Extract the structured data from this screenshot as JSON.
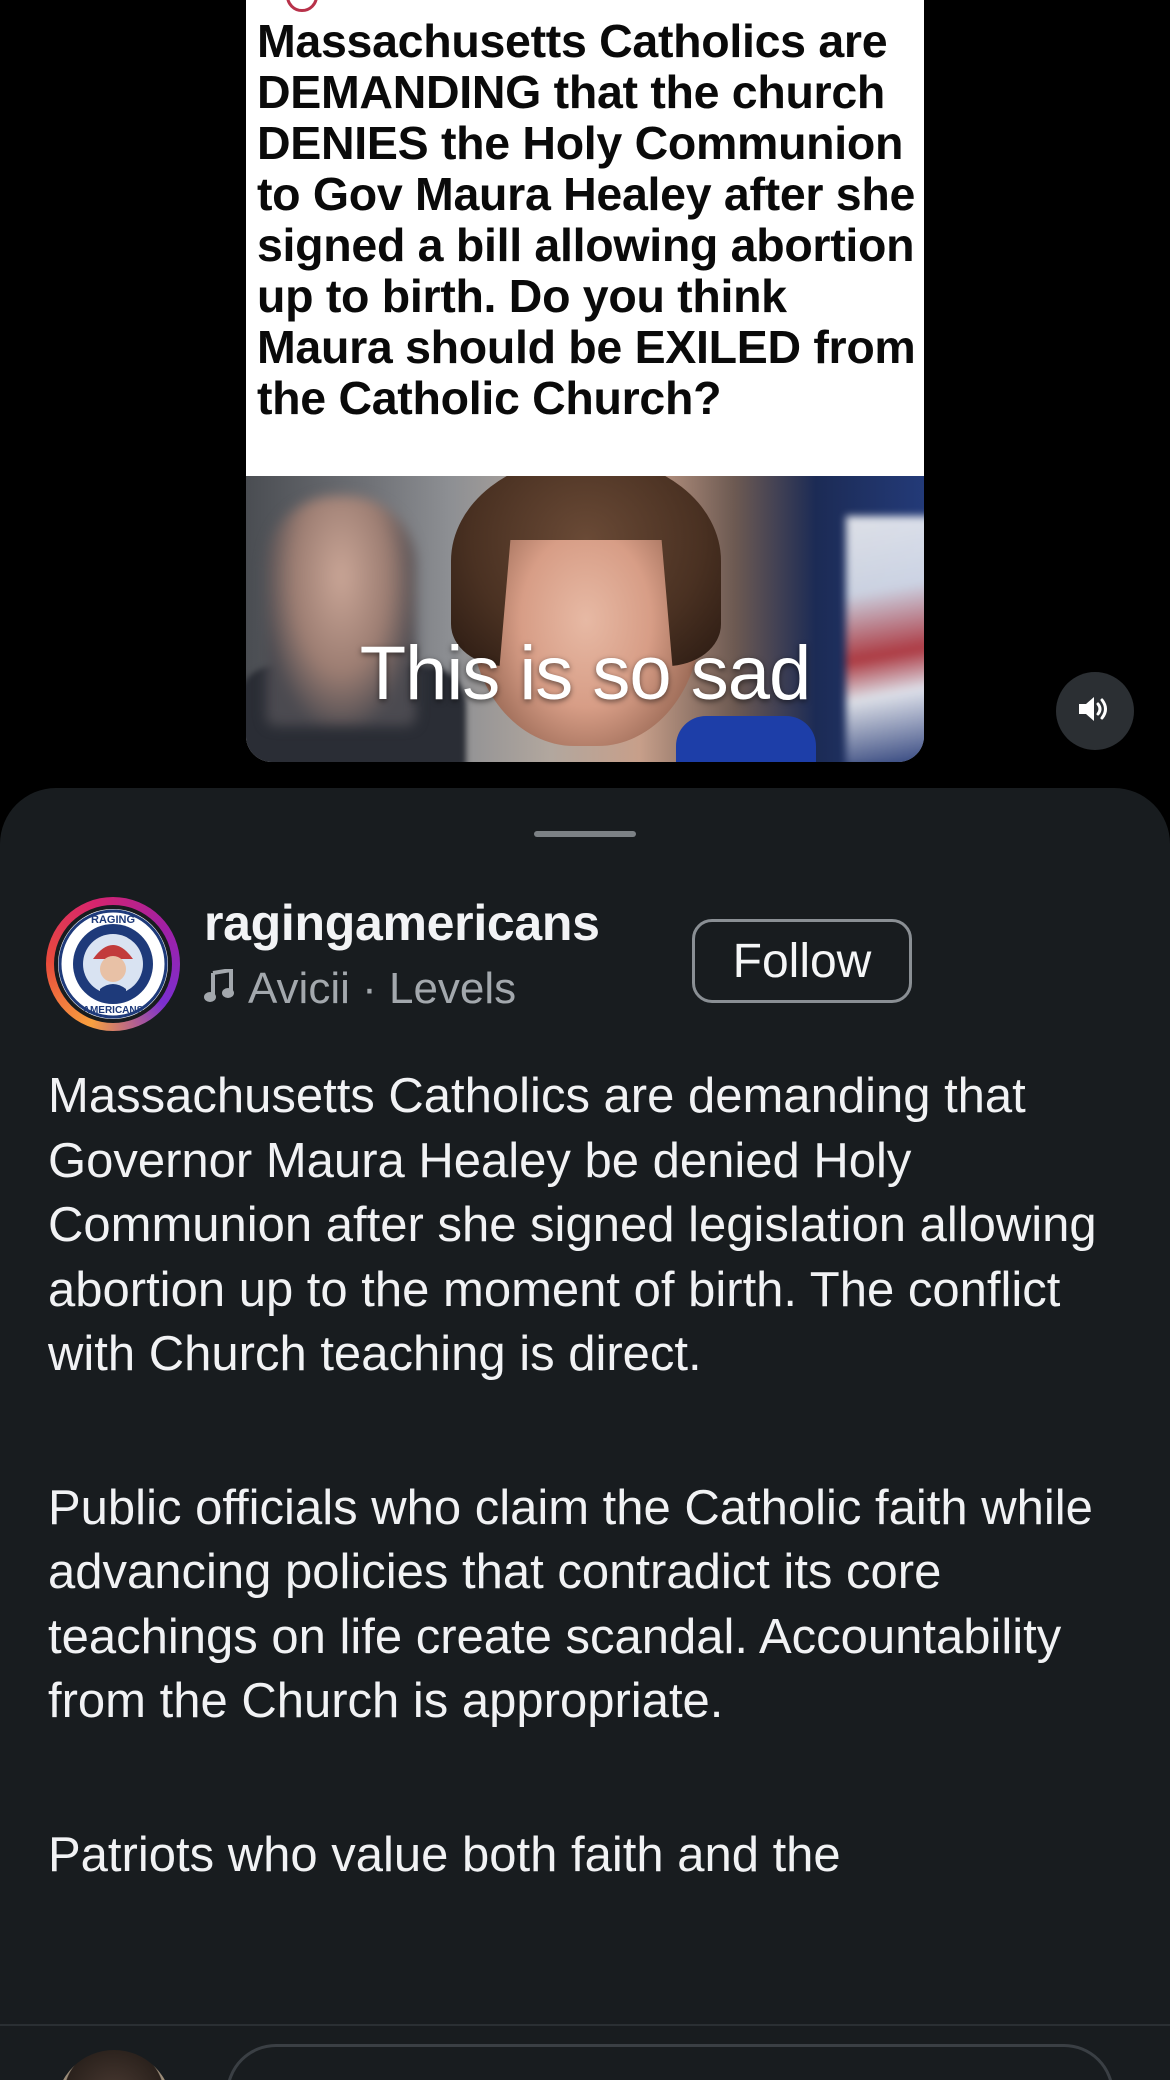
{
  "video": {
    "headline": "Massachusetts Catholics are DEMANDING that the church DENIES the Holy Communion to Gov Maura Healey after she signed a bill allowing abortion up to birth. Do you think Maura should be EXILED from the Catholic Church?",
    "caption_overlay": "This is so sad",
    "volume_icon": "speaker-on-icon"
  },
  "post": {
    "username": "ragingamericans",
    "avatar_icon": "raging-americans-logo",
    "audio_icon": "music-note-icon",
    "audio_track": "Avicii · Levels",
    "follow_label": "Follow",
    "description_paragraphs": [
      "Massachusetts Catholics are demanding that Governor Maura Healey be denied Holy Communion after she signed legislation allowing abortion up to the moment of birth. The conflict with Church teaching is direct.",
      "Public officials who claim the Catholic faith while advancing policies that contradict its core teachings on life create scandal. Accountability from the Church is appropriate.",
      "Patriots who value both faith and the"
    ]
  },
  "colors": {
    "sheet_background": "#181c1f",
    "page_background": "#000000",
    "text_primary": "#f1f2f4",
    "text_secondary": "#a3a8ad"
  }
}
